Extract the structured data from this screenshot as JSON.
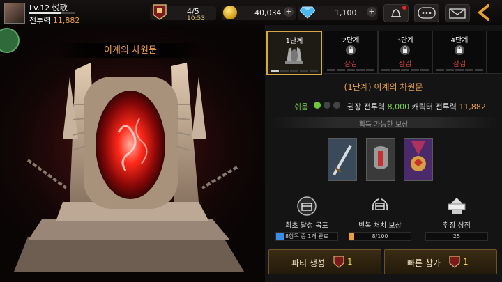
{
  "player": {
    "level_name": "Lv.12 悦歌",
    "cp_label": "전투력",
    "cp_value": "11,882",
    "xp_fraction": 0.7
  },
  "resources": {
    "tickets": "4/5",
    "ticket_timer": "10:53",
    "gold": "40,034",
    "gems": "1,100"
  },
  "gate": {
    "title": "이계의 차원문"
  },
  "stages": [
    {
      "label": "1단계",
      "locked": false,
      "progress": 3
    },
    {
      "label": "2단계",
      "locked": true,
      "locked_label": "잠김"
    },
    {
      "label": "3단계",
      "locked": true,
      "locked_label": "잠김"
    },
    {
      "label": "4단계",
      "locked": true,
      "locked_label": "잠김"
    }
  ],
  "stage_detail": {
    "title": "(1단계) 이계의 차원문",
    "difficulty": "쉬움",
    "recommend_label": "권장 전투력",
    "recommend_value": "8,000",
    "char_label": "캐릭터 전투력",
    "char_value": "11,882"
  },
  "rewards": {
    "label": "획득 가능한 보상",
    "items": [
      {
        "icon": "sword-icon"
      },
      {
        "icon": "armor-icon"
      },
      {
        "icon": "medal-icon"
      }
    ]
  },
  "goals": [
    {
      "label": "최초 달성 목표",
      "bar_text": "8항목 중 1개 완료",
      "fill": 0.125,
      "color": "#3a8ee8"
    },
    {
      "label": "반복 처치 보상",
      "bar_text": "8/100",
      "fill": 0.08,
      "color": "#e8a03a"
    },
    {
      "label": "휘장 상점",
      "bar_text": "25",
      "fill": 0,
      "color": "#e8a03a"
    }
  ],
  "buttons": {
    "create_party": "파티 생성",
    "create_party_cost": "1",
    "quick_join": "빠른 참가",
    "quick_join_cost": "1"
  }
}
